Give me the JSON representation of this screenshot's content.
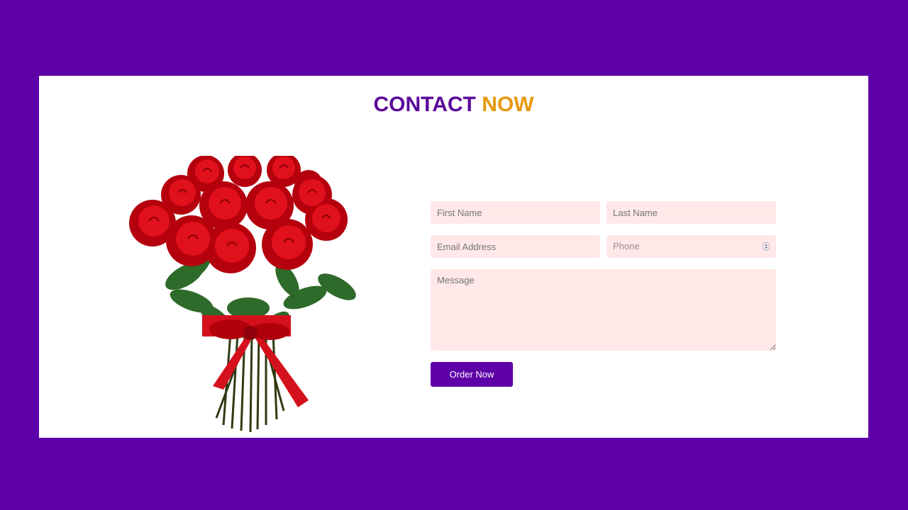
{
  "heading": {
    "word1": "CONTACT",
    "word2": "NOW"
  },
  "colors": {
    "background": "#5e00a8",
    "heading_primary": "#5a0a99",
    "heading_accent": "#e8990f",
    "field_bg": "#ffe8e8",
    "button_bg": "#5e00a8"
  },
  "image": {
    "icon": "rose-bouquet-image"
  },
  "form": {
    "first_name_placeholder": "First Name",
    "last_name_placeholder": "Last Name",
    "email_placeholder": "Email Address",
    "phone_placeholder": "Phone",
    "message_placeholder": "Message",
    "submit_label": "Order Now"
  }
}
